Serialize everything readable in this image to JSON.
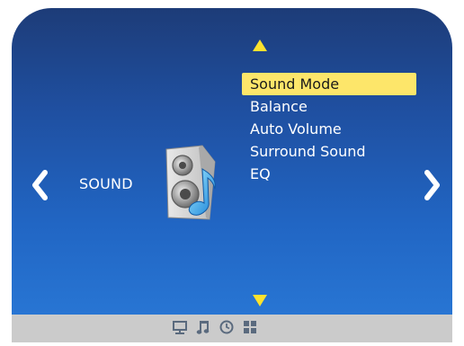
{
  "osd": {
    "section_label": "SOUND",
    "menu_items": [
      {
        "label": "Sound Mode",
        "selected": true
      },
      {
        "label": "Balance",
        "selected": false
      },
      {
        "label": "Auto Volume",
        "selected": false
      },
      {
        "label": "Surround Sound",
        "selected": false
      },
      {
        "label": "EQ",
        "selected": false
      }
    ]
  },
  "icons": {
    "up": "triangle-up-icon",
    "down": "triangle-down-icon",
    "prev": "chevron-left-icon",
    "next": "chevron-right-icon",
    "section": "speaker-music-note-icon",
    "bottom_tabs": [
      "monitor-icon",
      "music-note-icon",
      "clock-icon",
      "grid-icon"
    ]
  },
  "colors": {
    "background_top": "#1d3c78",
    "background_bottom": "#2a7ad8",
    "highlight": "#fde66a",
    "arrow": "#fde22e",
    "bottom_bar": "#cbcbcb",
    "bottom_icon": "#5a6a7e"
  }
}
